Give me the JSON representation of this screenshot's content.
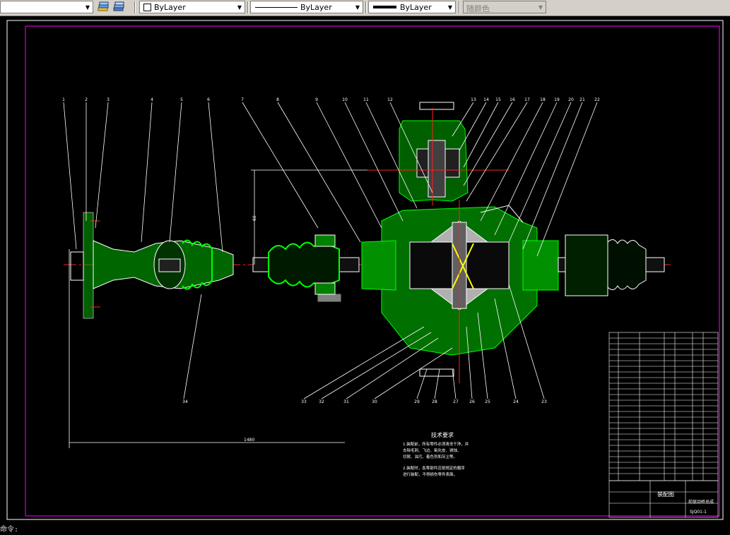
{
  "toolbar": {
    "layer_dropdown_arrow": "▼",
    "color_value": "ByLayer",
    "linetype_value": "ByLayer",
    "lineweight_value": "ByLayer",
    "plotstyle_value": "随颜色"
  },
  "drawing": {
    "tech_title": "技术要求",
    "tech_lines": [
      "1.装配前，所有零件必须清洗干净，并",
      "去除毛刺、飞边、氧化皮、锈蚀、",
      "切屑、油污、着色剂和灰尘等。",
      "2.装配时，各零部件应按规定的顺序",
      "进行装配，不得损伤零件表面。"
    ],
    "dim_width": "1480",
    "dim_height": "60",
    "title_block": {
      "name": "装配图",
      "product": "前驱动桥总成",
      "code": "SJQ01-1"
    },
    "balloons_top": [
      "1",
      "2",
      "3",
      "4",
      "5",
      "6",
      "7",
      "8",
      "9",
      "10",
      "11",
      "12",
      "13",
      "14",
      "15",
      "16",
      "17",
      "18",
      "19",
      "20",
      "21",
      "22"
    ],
    "balloons_bottom": [
      "34",
      "33",
      "32",
      "31",
      "30",
      "29",
      "28",
      "27",
      "26",
      "25",
      "24",
      "23"
    ]
  },
  "colors": {
    "background": "#000000",
    "green_hatch": "#00cc00",
    "red_center": "#ff2020",
    "leader": "#ffffff",
    "border": "#ff00ff",
    "yellow": "#ffff00"
  },
  "status": {
    "command_prompt": "命令:"
  }
}
